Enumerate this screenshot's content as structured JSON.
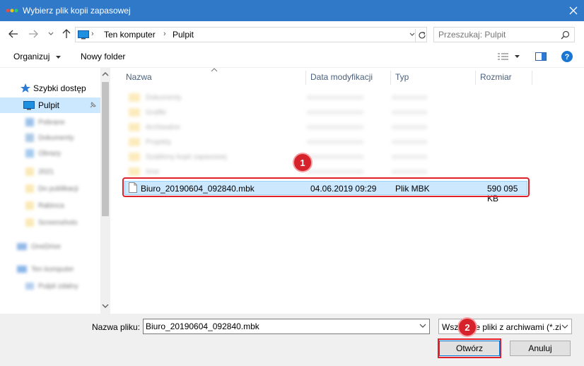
{
  "window": {
    "title": "Wybierz plik kopii zapasowej"
  },
  "address": {
    "crumbs": [
      "Ten komputer",
      "Pulpit"
    ]
  },
  "search": {
    "placeholder": "Przeszukaj: Pulpit"
  },
  "toolbar": {
    "organize": "Organizuj",
    "new_folder": "Nowy folder"
  },
  "nav": {
    "quick_access": "Szybki dostęp",
    "selected": "Pulpit",
    "blurred_items": [
      "Pobrane",
      "Dokumenty",
      "Obrazy",
      "2021",
      "Do publikacji",
      "Rabinca",
      "Screenshots",
      "OneDrive",
      "Ten komputer",
      "Pulpit zdalny"
    ]
  },
  "columns": {
    "name": "Nazwa",
    "modified": "Data modyfikacji",
    "type": "Typ",
    "size": "Rozmiar"
  },
  "files": {
    "blurred_folders": [
      "Dokumenty",
      "Grafiki",
      "Archiwalne",
      "Projekty",
      "Szablony kopii zapasowej",
      "Inne"
    ],
    "selected": {
      "name": "Biuro_20190604_092840.mbk",
      "modified": "04.06.2019 09:29",
      "type": "Plik MBK",
      "size": "590 095 KB"
    }
  },
  "bottom": {
    "filename_label": "Nazwa pliku:",
    "filename_value": "Biuro_20190604_092840.mbk",
    "filetype": "Wszystkie pliki z archiwami (*.zi",
    "open_button": "Otwórz",
    "cancel_button": "Anuluj"
  },
  "annotations": {
    "step1": "1",
    "step2": "2"
  },
  "colors": {
    "titlebar": "#2f79c8",
    "selection": "#cce8ff",
    "highlight": "#e0202a",
    "folder": "#f7d77a"
  }
}
